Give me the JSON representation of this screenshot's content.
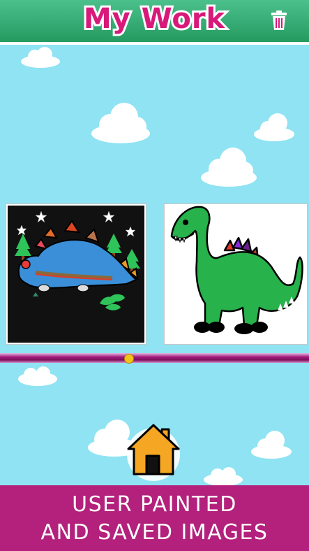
{
  "header": {
    "title": "My Work",
    "trash_icon": "trash-icon"
  },
  "gallery": {
    "items": [
      {
        "name": "stegosaurus-painting"
      },
      {
        "name": "brontosaurus-painting"
      }
    ],
    "pages": 1,
    "current_page": 1
  },
  "home_icon": "home-icon",
  "footer": {
    "line1": "USER PAINTED",
    "line2": "AND SAVED IMAGES"
  },
  "colors": {
    "header": "#2fac6d",
    "title": "#d8197a",
    "sky": "#8fe3f3",
    "footer": "#b3217c",
    "home": "#f5a623"
  }
}
